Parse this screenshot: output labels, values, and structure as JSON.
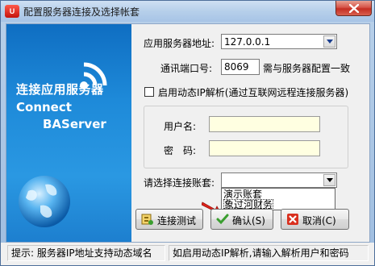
{
  "window": {
    "title": "配置服务器连接及选择帐套",
    "app_icon_text": "U"
  },
  "banner": {
    "line1": "连接应用服务器",
    "line2": "Connect",
    "line3": "BAServer"
  },
  "form": {
    "server_label": "应用服务器地址:",
    "server_value": "127.0.0.1",
    "port_label": "通讯端口号:",
    "port_value": "8069",
    "port_hint": "需与服务器配置一致",
    "dynamic_ip_label": "启用动态IP解析(通过互联网远程连接服务器)",
    "dynamic_ip_checked": false,
    "username_label": "用户名:",
    "username_value": "",
    "password_label": "密　码:",
    "password_value": "",
    "account_label": "请选择连接账套:",
    "account_value": "",
    "account_options": [
      "演示账套",
      "象过河财务"
    ],
    "account_highlighted": "象过河财务"
  },
  "buttons": {
    "test_label": "连接测试",
    "ok_label": "确认(S)",
    "cancel_label": "取消(C)"
  },
  "status": {
    "tip": "提示: 服务器IP地址支持动态域名",
    "tip2": "如启用动态IP解析,请输入解析用户和密码"
  },
  "colors": {
    "banner_blue": "#1e8ad9",
    "input_yellow": "#ffffe1",
    "arrow_red": "#e0231b",
    "ok_icon_green": "#3a9e2f",
    "cancel_icon_red": "#d9301f"
  }
}
